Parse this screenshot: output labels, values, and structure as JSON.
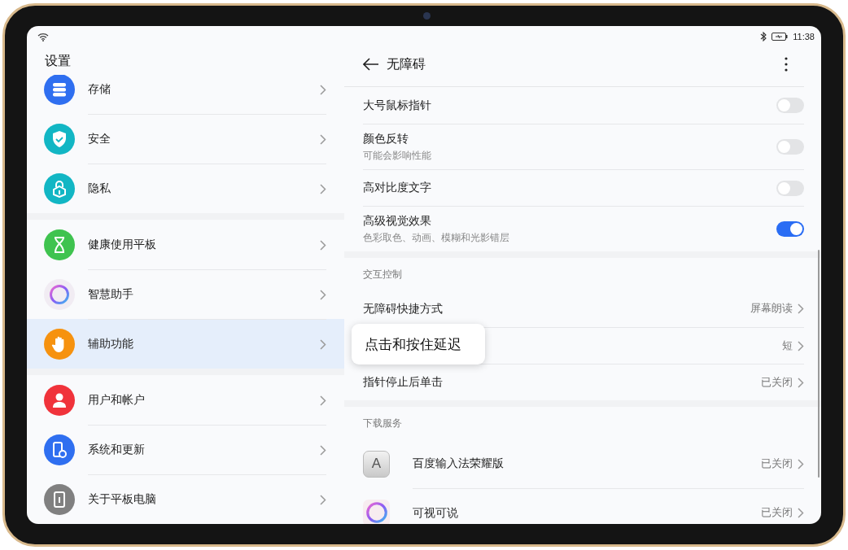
{
  "status_bar": {
    "time": "11:38"
  },
  "sidebar": {
    "title": "设置",
    "groups": [
      {
        "items": [
          {
            "label": "存储",
            "color": "#2f6ff0",
            "selected": false
          },
          {
            "label": "安全",
            "color": "#12b6c4",
            "selected": false
          },
          {
            "label": "隐私",
            "color": "#12b6c4",
            "selected": false
          }
        ]
      },
      {
        "items": [
          {
            "label": "健康使用平板",
            "color": "#3fc34f",
            "selected": false
          },
          {
            "label": "智慧助手",
            "color": "#f1ecf3",
            "selected": false
          },
          {
            "label": "辅助功能",
            "color": "#f6920f",
            "selected": true
          }
        ]
      },
      {
        "items": [
          {
            "label": "用户和帐户",
            "color": "#f0333b",
            "selected": false
          },
          {
            "label": "系统和更新",
            "color": "#2f6ff0",
            "selected": false
          },
          {
            "label": "关于平板电脑",
            "color": "#808080",
            "selected": false
          }
        ]
      }
    ]
  },
  "page": {
    "title": "无障碍",
    "sections": [
      {
        "rows": [
          {
            "kind": "toggle",
            "label": "大号鼠标指针",
            "on": false
          },
          {
            "kind": "toggle",
            "label": "颜色反转",
            "sublabel": "可能会影响性能",
            "on": false
          },
          {
            "kind": "toggle",
            "label": "高对比度文字",
            "on": false
          },
          {
            "kind": "toggle",
            "label": "高级视觉效果",
            "sublabel": "色彩取色、动画、模糊和光影错层",
            "on": true
          }
        ]
      },
      {
        "header": "交互控制",
        "rows": [
          {
            "kind": "link",
            "label": "无障碍快捷方式",
            "value": "屏幕朗读"
          },
          {
            "kind": "link",
            "value": "短",
            "tooltip": "点击和按住延迟"
          },
          {
            "kind": "link",
            "label": "指针停止后单击",
            "value": "已关闭"
          }
        ]
      },
      {
        "header": "下载服务",
        "rows": [
          {
            "kind": "app",
            "icon_text": "A",
            "label": "百度输入法荣耀版",
            "value": "已关闭"
          },
          {
            "kind": "app",
            "label": "可视可说",
            "value": "已关闭"
          }
        ]
      }
    ]
  }
}
